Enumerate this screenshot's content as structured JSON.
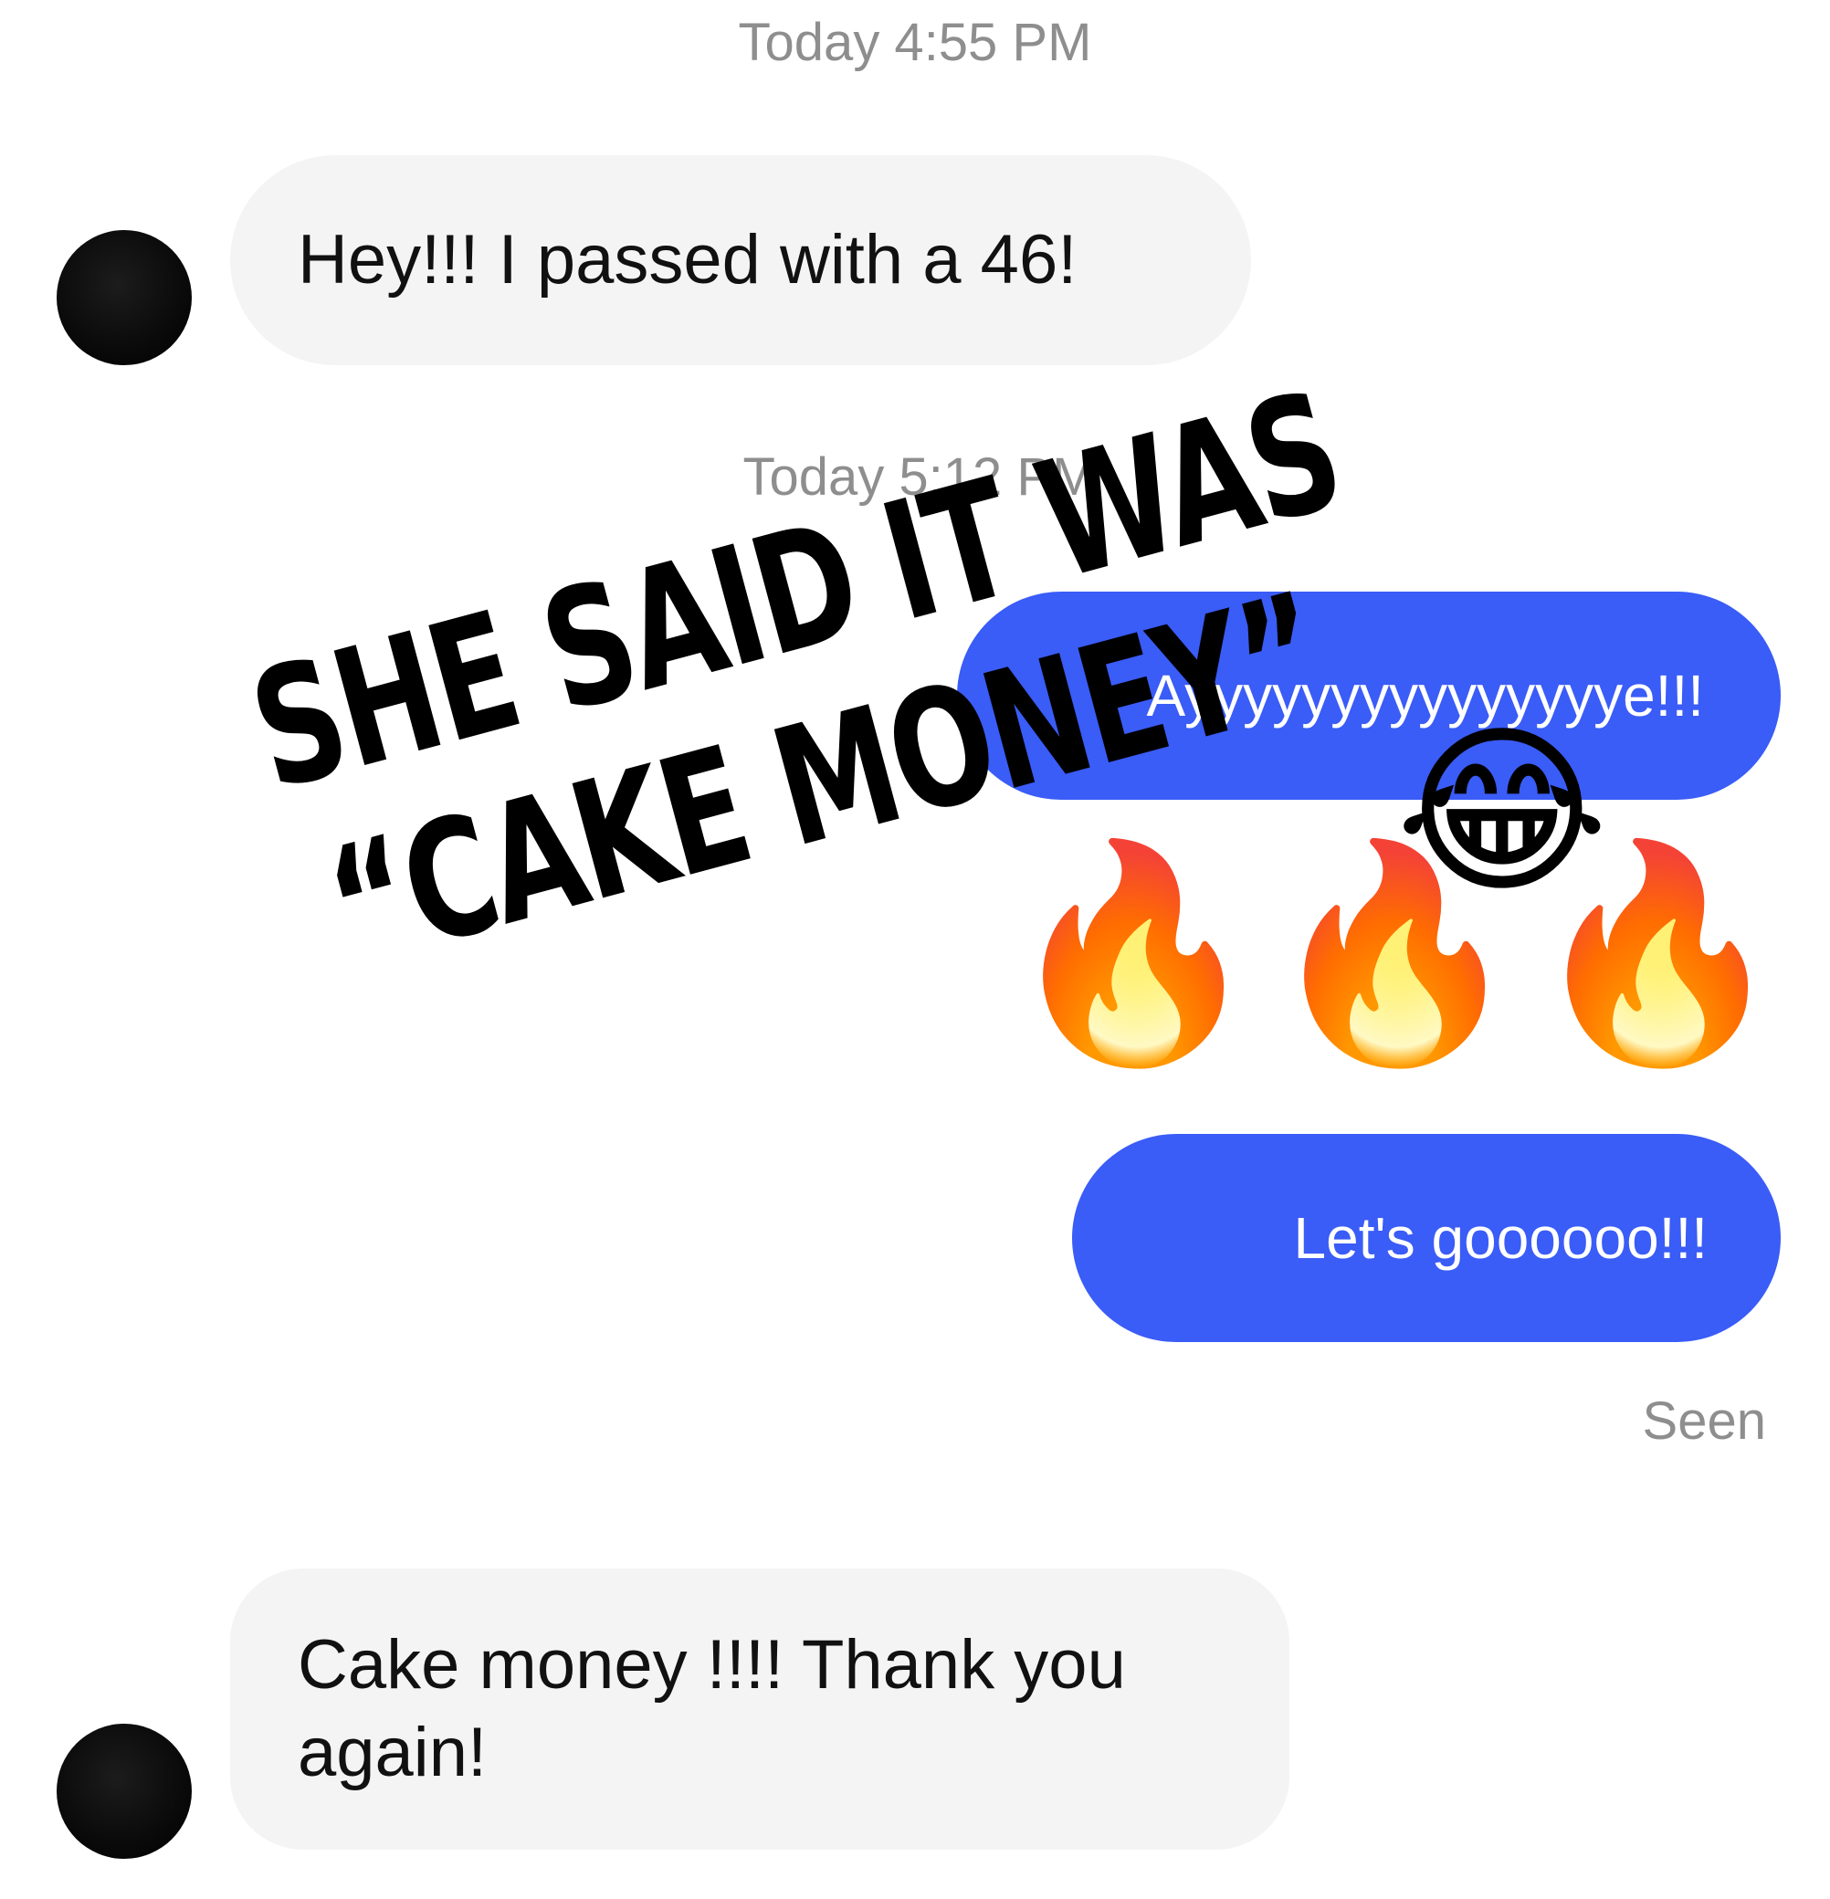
{
  "timestamps": {
    "first": "Today 4:55 PM",
    "second": "Today 5:12 PM"
  },
  "messages": {
    "incoming_1": "Hey!!! I passed with a 46!",
    "outgoing_1": "Ayyyyyyyyyyyyyyye!!!",
    "outgoing_2": "Let's goooooo!!!",
    "incoming_2": "Cake money !!!! Thank you again!"
  },
  "emojis": {
    "laugh": "😂",
    "fire": "🔥"
  },
  "status": {
    "seen": "Seen"
  },
  "overlay": {
    "line1": "SHE SAID IT WAS",
    "line2": "“CAKE MONEY”"
  },
  "colors": {
    "outgoing_bubble": "#3a5cf7",
    "incoming_bubble": "#f4f4f4",
    "timestamp_text": "#8e8e8e",
    "overlay_text": "#000000"
  }
}
